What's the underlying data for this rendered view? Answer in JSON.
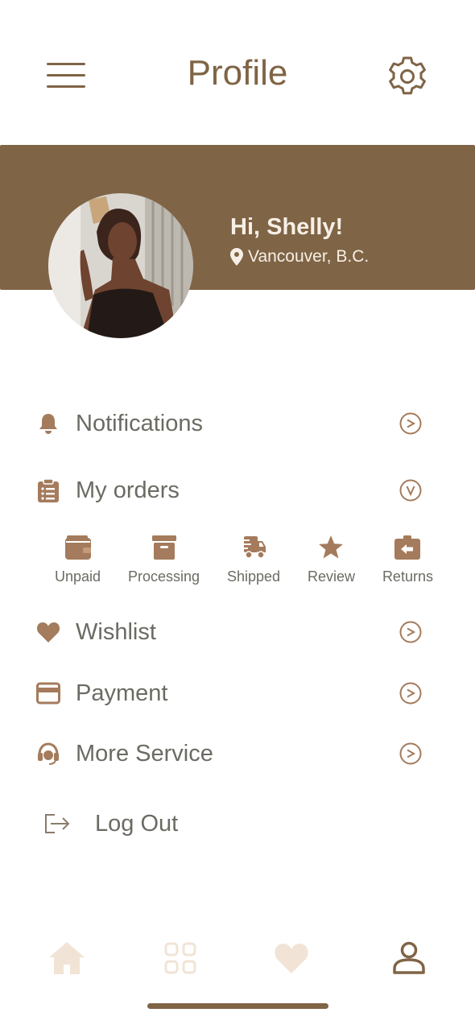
{
  "header": {
    "title": "Profile"
  },
  "profile": {
    "greeting": "Hi, Shelly!",
    "location": "Vancouver, B.C."
  },
  "menu": {
    "notifications": "Notifications",
    "my_orders": "My orders",
    "wishlist": "Wishlist",
    "payment": "Payment",
    "more_service": "More Service",
    "log_out": "Log Out"
  },
  "orders": {
    "unpaid": "Unpaid",
    "processing": "Processing",
    "shipped": "Shipped",
    "review": "Review",
    "returns": "Returns"
  },
  "colors": {
    "brand": "#7f6446",
    "icon": "#a47b5c",
    "text": "#6b6b63",
    "inactive_tab": "#f1e4d6"
  },
  "icons": {
    "menu": "hamburger-icon",
    "settings": "gear-icon",
    "location": "map-pin-icon",
    "notifications": "bell-icon",
    "orders": "clipboard-list-icon",
    "wishlist": "heart-icon",
    "payment": "credit-card-icon",
    "more_service": "headset-icon",
    "log_out": "sign-out-icon"
  }
}
